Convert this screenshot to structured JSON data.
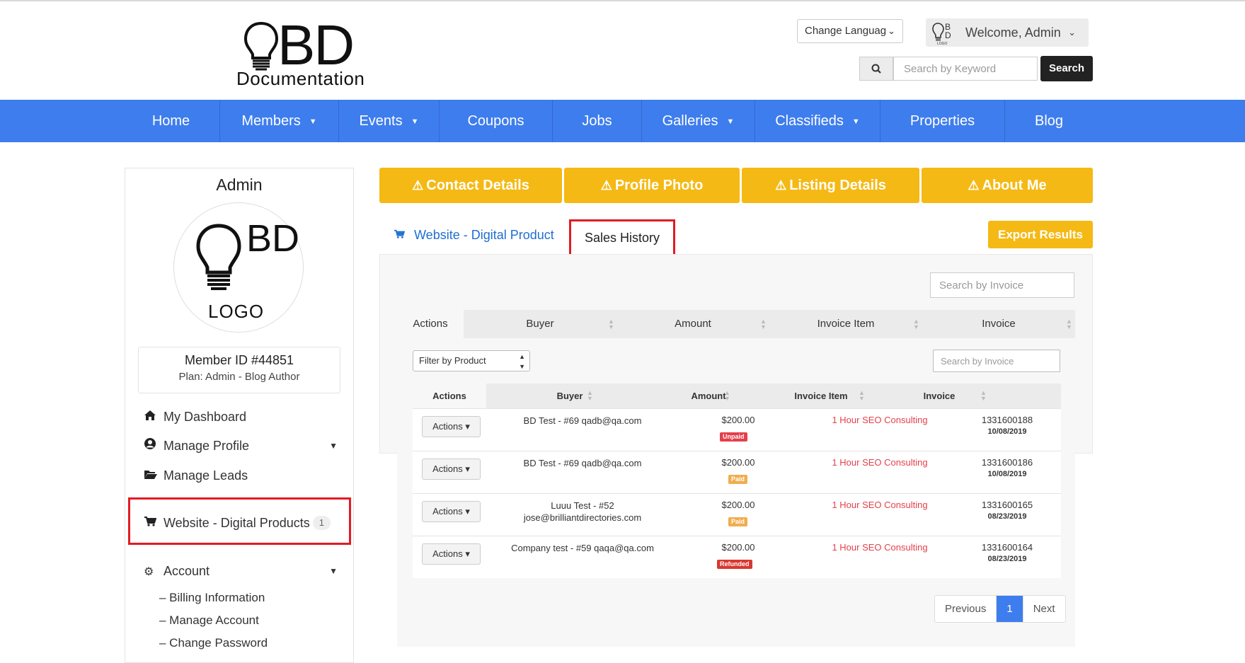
{
  "header": {
    "logo_bd": "BD",
    "logo_subtitle": "Documentation",
    "language_label": "Change Languag",
    "welcome_text": "Welcome, Admin",
    "search_placeholder": "Search by Keyword",
    "search_button": "Search"
  },
  "nav": {
    "items": [
      "Home",
      "Members",
      "Events",
      "Coupons",
      "Jobs",
      "Galleries",
      "Classifieds",
      "Properties",
      "Blog"
    ]
  },
  "sidebar": {
    "name": "Admin",
    "avatar_letters": "BD",
    "avatar_logo": "LOGO",
    "member_id": "Member ID #44851",
    "plan": "Plan: Admin - Blog Author",
    "menu": [
      "My Dashboard",
      "Manage Profile",
      "Manage Leads",
      "Website - Digital Products",
      "Account"
    ],
    "digital_count": "1",
    "account_sub": [
      "– Billing Information",
      "– Manage Account",
      "– Change Password"
    ]
  },
  "profile_buttons": [
    "Contact Details",
    "Profile Photo",
    "Listing Details",
    "About Me"
  ],
  "tabs": {
    "website": "Website - Digital Product",
    "sales_history": "Sales History",
    "export": "Export Results"
  },
  "outer_table": {
    "search_placeholder": "Search by Invoice",
    "headers": [
      "Actions",
      "Buyer",
      "Amount",
      "Invoice Item",
      "Invoice"
    ]
  },
  "inner_table": {
    "filter_label": "Filter by Product",
    "search_placeholder": "Search by Invoice",
    "headers": [
      "Actions",
      "Buyer",
      "Amount",
      "Invoice Item",
      "Invoice"
    ],
    "rows": [
      {
        "action": "Actions",
        "buyer_line1": "BD Test - #69 qadb@qa.com",
        "buyer_line2": "",
        "amount": "$200.00",
        "status": "Unpaid",
        "status_color": "#e4404b",
        "item": "1 Hour SEO Consulting",
        "invoice": "1331600188",
        "date": "10/08/2019"
      },
      {
        "action": "Actions",
        "buyer_line1": "BD Test - #69 qadb@qa.com",
        "buyer_line2": "",
        "amount": "$200.00",
        "status": "Paid",
        "status_color": "#f0ad4e",
        "item": "1 Hour SEO Consulting",
        "invoice": "1331600186",
        "date": "10/08/2019"
      },
      {
        "action": "Actions",
        "buyer_line1": "Luuu Test - #52",
        "buyer_line2": "jose@brilliantdirectories.com",
        "amount": "$200.00",
        "status": "Paid",
        "status_color": "#f0ad4e",
        "item": "1 Hour SEO Consulting",
        "invoice": "1331600165",
        "date": "08/23/2019"
      },
      {
        "action": "Actions",
        "buyer_line1": "Company test - #59 qaqa@qa.com",
        "buyer_line2": "",
        "amount": "$200.00",
        "status": "Refunded",
        "status_color": "#d9372f",
        "item": "1 Hour SEO Consulting",
        "invoice": "1331600164",
        "date": "08/23/2019"
      }
    ]
  },
  "pagination": {
    "previous": "Previous",
    "current": "1",
    "next": "Next"
  },
  "colors": {
    "nav_blue": "#3e7ded",
    "accent_yellow": "#f5b915",
    "highlight_red": "#e21b23",
    "link_blue": "#1f6fd0"
  }
}
